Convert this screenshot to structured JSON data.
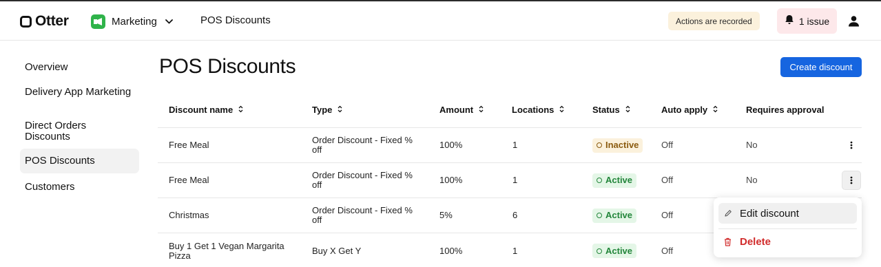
{
  "header": {
    "logo_text": "Otter",
    "app_name": "Marketing",
    "breadcrumb": "POS Discounts",
    "recorded_badge": "Actions are recorded",
    "issues_label": "1 issue"
  },
  "sidebar": {
    "items": [
      {
        "label": "Overview"
      },
      {
        "label": "Delivery App Marketing"
      },
      {
        "label": "Direct Orders Discounts"
      },
      {
        "label": "POS Discounts",
        "active": true
      },
      {
        "label": "Customers"
      }
    ]
  },
  "main": {
    "title": "POS Discounts",
    "create_button": "Create discount",
    "columns": [
      "Discount name",
      "Type",
      "Amount",
      "Locations",
      "Status",
      "Auto apply",
      "Requires approval"
    ],
    "rows": [
      {
        "name": "Free Meal",
        "type": "Order Discount - Fixed % off",
        "amount": "100%",
        "locations": "1",
        "status": "Inactive",
        "auto_apply": "Off",
        "requires_approval": "No"
      },
      {
        "name": "Free Meal",
        "type": "Order Discount - Fixed % off",
        "amount": "100%",
        "locations": "1",
        "status": "Active",
        "auto_apply": "Off",
        "requires_approval": "No"
      },
      {
        "name": "Christmas",
        "type": "Order Discount - Fixed % off",
        "amount": "5%",
        "locations": "6",
        "status": "Active",
        "auto_apply": "Off",
        "requires_approval": ""
      },
      {
        "name": "Buy 1 Get 1 Vegan Margarita Pizza",
        "type": "Buy X Get Y",
        "amount": "100%",
        "locations": "1",
        "status": "Active",
        "auto_apply": "Off",
        "requires_approval": ""
      }
    ]
  },
  "row_menu": {
    "edit_label": "Edit discount",
    "delete_label": "Delete"
  },
  "colors": {
    "accent": "#1665e0",
    "app_icon": "#2fb34a",
    "status_active": "#22853a",
    "status_inactive": "#8a5a0e",
    "delete": "#d12b2b"
  },
  "icons": [
    "otter-logo-icon",
    "marketing-app-icon",
    "chevron-down-icon",
    "bell-icon",
    "user-icon",
    "sort-icon",
    "more-vertical-icon",
    "pencil-icon",
    "trash-icon"
  ]
}
